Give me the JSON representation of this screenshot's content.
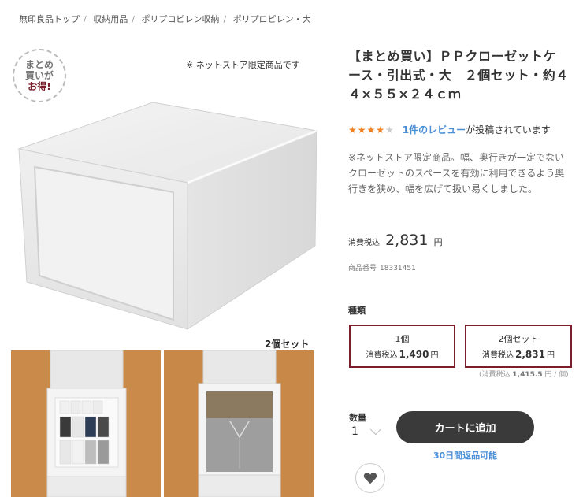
{
  "breadcrumb": [
    "無印良品トップ",
    "収納用品",
    "ポリプロピレン収納",
    "ポリプロピレン・大"
  ],
  "badge": {
    "line1": "まとめ",
    "line2": "買いが",
    "line3": "お得!"
  },
  "limited_note": "※ ネットストア限定商品です",
  "thumbs_label": "2個セット",
  "title": "【まとめ買い】ＰＰクローゼットケース・引出式・大　２個セット・約４４×５５×２４ｃｍ",
  "rating": {
    "stars_filled": 4,
    "stars_total": 5,
    "review_link": "1件のレビュー",
    "review_rest": "が投稿されています"
  },
  "description": "※ネットストア限定商品。幅、奥行きが一定でないクローゼットのスペースを有効に利用できるよう奥行きを狭め、幅を広げて扱い易くしました。",
  "price": {
    "tax_label": "消費税込",
    "amount": "2,831",
    "yen": "円"
  },
  "sku": {
    "label": "商品番号",
    "value": "18331451"
  },
  "kind": {
    "label": "種類",
    "options": [
      {
        "name": "1個",
        "tax_label": "消費税込",
        "amount": "1,490",
        "yen": "円"
      },
      {
        "name": "2個セット",
        "tax_label": "消費税込",
        "amount": "2,831",
        "yen": "円"
      }
    ],
    "unit_note_prefix": "(消費税込",
    "unit_note_amount": "1,415.5",
    "unit_note_suffix": "円 / 個)"
  },
  "quantity": {
    "label": "数量",
    "value": "1"
  },
  "cart_button": "カートに追加",
  "return_note": "30日間返品可能",
  "icons": {
    "favorite": "heart-icon",
    "chevron": "chevron-down-icon"
  },
  "colors": {
    "accent": "#7a1e2b",
    "link": "#4a8fd6",
    "star": "#f08020",
    "cart": "#3a3a3a"
  }
}
